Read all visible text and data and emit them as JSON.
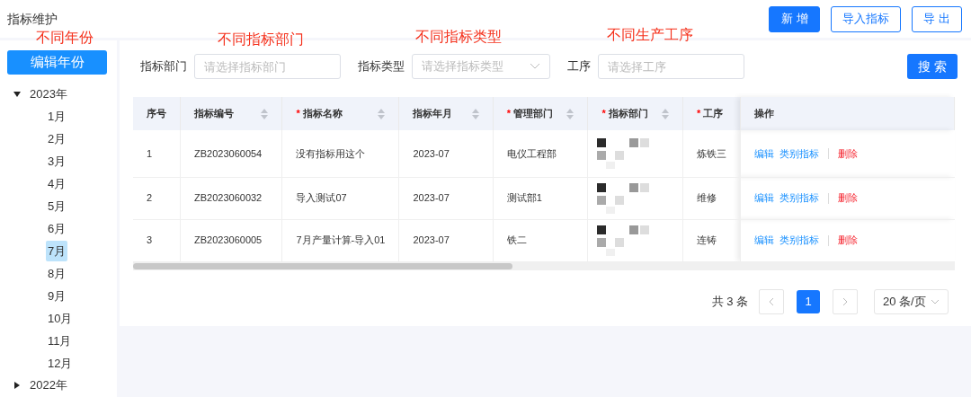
{
  "page_title": "指标维护",
  "header_buttons": [
    {
      "label": "新 增",
      "kind": "primary"
    },
    {
      "label": "导入指标",
      "kind": "outline"
    },
    {
      "label": "导 出",
      "kind": "outline"
    }
  ],
  "annotations": [
    "不同年份",
    "不同指标部门",
    "不同指标类型",
    "不同生产工序"
  ],
  "sidebar": {
    "button": "编辑年份",
    "tree": [
      {
        "label": "2023年",
        "expanded": true,
        "children": [
          {
            "label": "1月",
            "selected": false
          },
          {
            "label": "2月",
            "selected": false
          },
          {
            "label": "3月",
            "selected": false
          },
          {
            "label": "4月",
            "selected": false
          },
          {
            "label": "5月",
            "selected": false
          },
          {
            "label": "6月",
            "selected": false
          },
          {
            "label": "7月",
            "selected": true
          },
          {
            "label": "8月",
            "selected": false
          },
          {
            "label": "9月",
            "selected": false
          },
          {
            "label": "10月",
            "selected": false
          },
          {
            "label": "11月",
            "selected": false
          },
          {
            "label": "12月",
            "selected": false
          }
        ]
      },
      {
        "label": "2022年",
        "expanded": false
      }
    ]
  },
  "filters": [
    {
      "label": "指标部门",
      "placeholder": "请选择指标部门",
      "kind": "input"
    },
    {
      "label": "指标类型",
      "placeholder": "请选择指标类型",
      "kind": "select"
    },
    {
      "label": "工序",
      "placeholder": "请选择工序",
      "kind": "input"
    }
  ],
  "search_button": "搜 索",
  "table": {
    "columns": [
      {
        "label": "序号",
        "sortable": false
      },
      {
        "label": "指标编号",
        "sortable": true
      },
      {
        "required_mark": "*",
        "label": "指标名称",
        "sortable": true
      },
      {
        "label": "指标年月",
        "sortable": true
      },
      {
        "required_mark": "*",
        "label": "管理部门",
        "sortable": true
      },
      {
        "required_mark": "*",
        "label": "指标部门",
        "sortable": true
      },
      {
        "required_mark": "*",
        "label": "工序",
        "sortable": false
      },
      {
        "label": "操作",
        "sortable": false
      }
    ],
    "rows": [
      {
        "index": "1",
        "code": "ZB2023060054",
        "name": "没有指标用这个",
        "month": "2023-07",
        "mgmt_dept": "电仪工程部",
        "indicator_dept_redacted": true,
        "process": "炼铁三",
        "actions": [
          "编辑",
          "类别指标",
          "删除"
        ]
      },
      {
        "index": "2",
        "code": "ZB2023060032",
        "name": "导入测试07",
        "month": "2023-07",
        "mgmt_dept": "测试部1",
        "indicator_dept_redacted": true,
        "process": "维修",
        "actions": [
          "编辑",
          "类别指标",
          "删除"
        ]
      },
      {
        "index": "3",
        "code": "ZB2023060005",
        "name": "7月产量计算-导入01",
        "month": "2023-07",
        "mgmt_dept": "铁二",
        "indicator_dept_redacted": true,
        "process": "连铸",
        "actions": [
          "编辑",
          "类别指标",
          "删除"
        ]
      }
    ]
  },
  "pagination": {
    "total": "共 3 条",
    "pages": [
      {
        "label": "1",
        "selected": true
      }
    ],
    "page_size": "20 条/页"
  }
}
